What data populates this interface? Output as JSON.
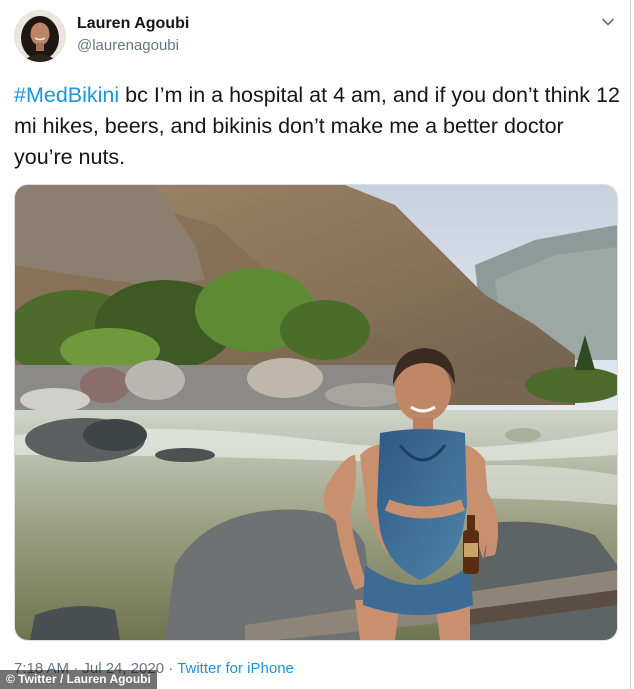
{
  "user": {
    "display_name": "Lauren Agoubi",
    "handle": "@laurenagoubi"
  },
  "tweet": {
    "hashtag": "#MedBikini",
    "text": " bc I’m in a hospital at 4 am, and if you don’t think 12 mi hikes, beers, and bikinis don’t make me a better doctor you’re nuts.",
    "timestamp": "7:18 AM · Jul 24, 2020",
    "separator": " · ",
    "source": "Twitter for iPhone"
  },
  "media": {
    "icon": "photo-of-woman-in-swimsuit-by-river"
  },
  "credit": {
    "text": "© Twitter / Lauren Agoubi"
  },
  "icons": {
    "menu": "chevron-down-icon"
  },
  "colors": {
    "link": "#1b95e0",
    "secondary_text": "#657786",
    "primary_text": "#14171a"
  }
}
